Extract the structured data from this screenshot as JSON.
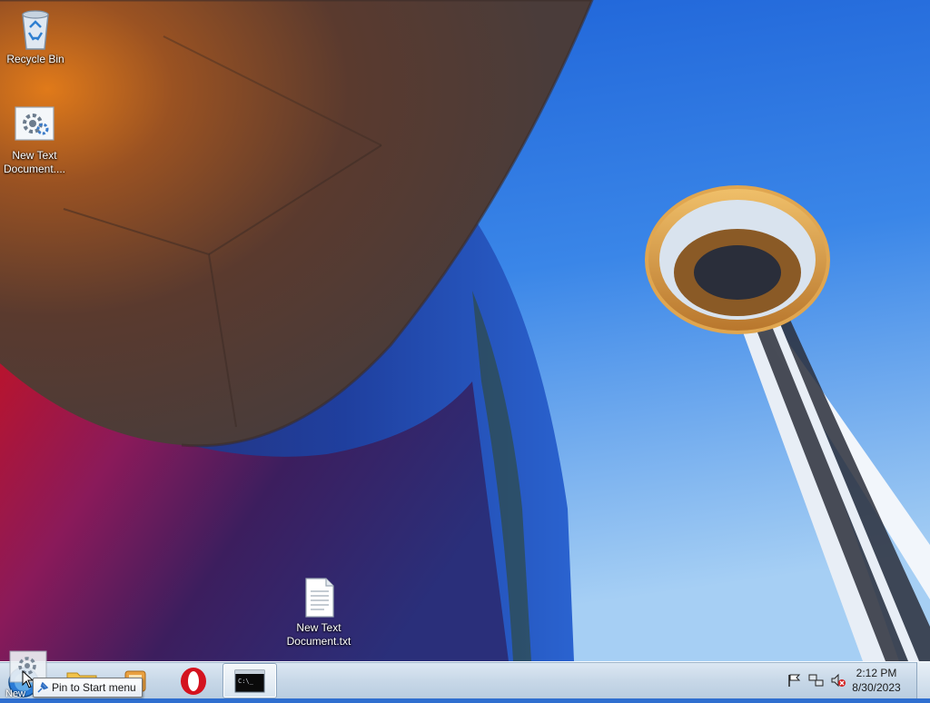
{
  "desktop": {
    "icons": [
      {
        "label": "Recycle Bin",
        "icon": "recycle-bin-icon"
      },
      {
        "label": "New Text Document....",
        "icon": "settings-gear-document-icon"
      },
      {
        "label": "New Text Document.txt",
        "icon": "text-file-icon"
      }
    ]
  },
  "taskbar": {
    "start_hover_label": "New",
    "pinned": [
      {
        "name": "windows-explorer",
        "icon": "folder-icon"
      },
      {
        "name": "windows-media",
        "icon": "media-player-icon"
      },
      {
        "name": "opera",
        "icon": "opera-icon"
      },
      {
        "name": "command-prompt",
        "icon": "cmd-icon"
      }
    ],
    "tooltip": "Pin to Start menu",
    "tray": {
      "icons": [
        "action-center-flag-icon",
        "network-icon",
        "volume-muted-icon"
      ],
      "time": "2:12 PM",
      "date": "8/30/2023"
    }
  },
  "colors": {
    "sky": "#2f74dc",
    "opera_red": "#d4121f",
    "taskbar": "#c8d8e8"
  }
}
